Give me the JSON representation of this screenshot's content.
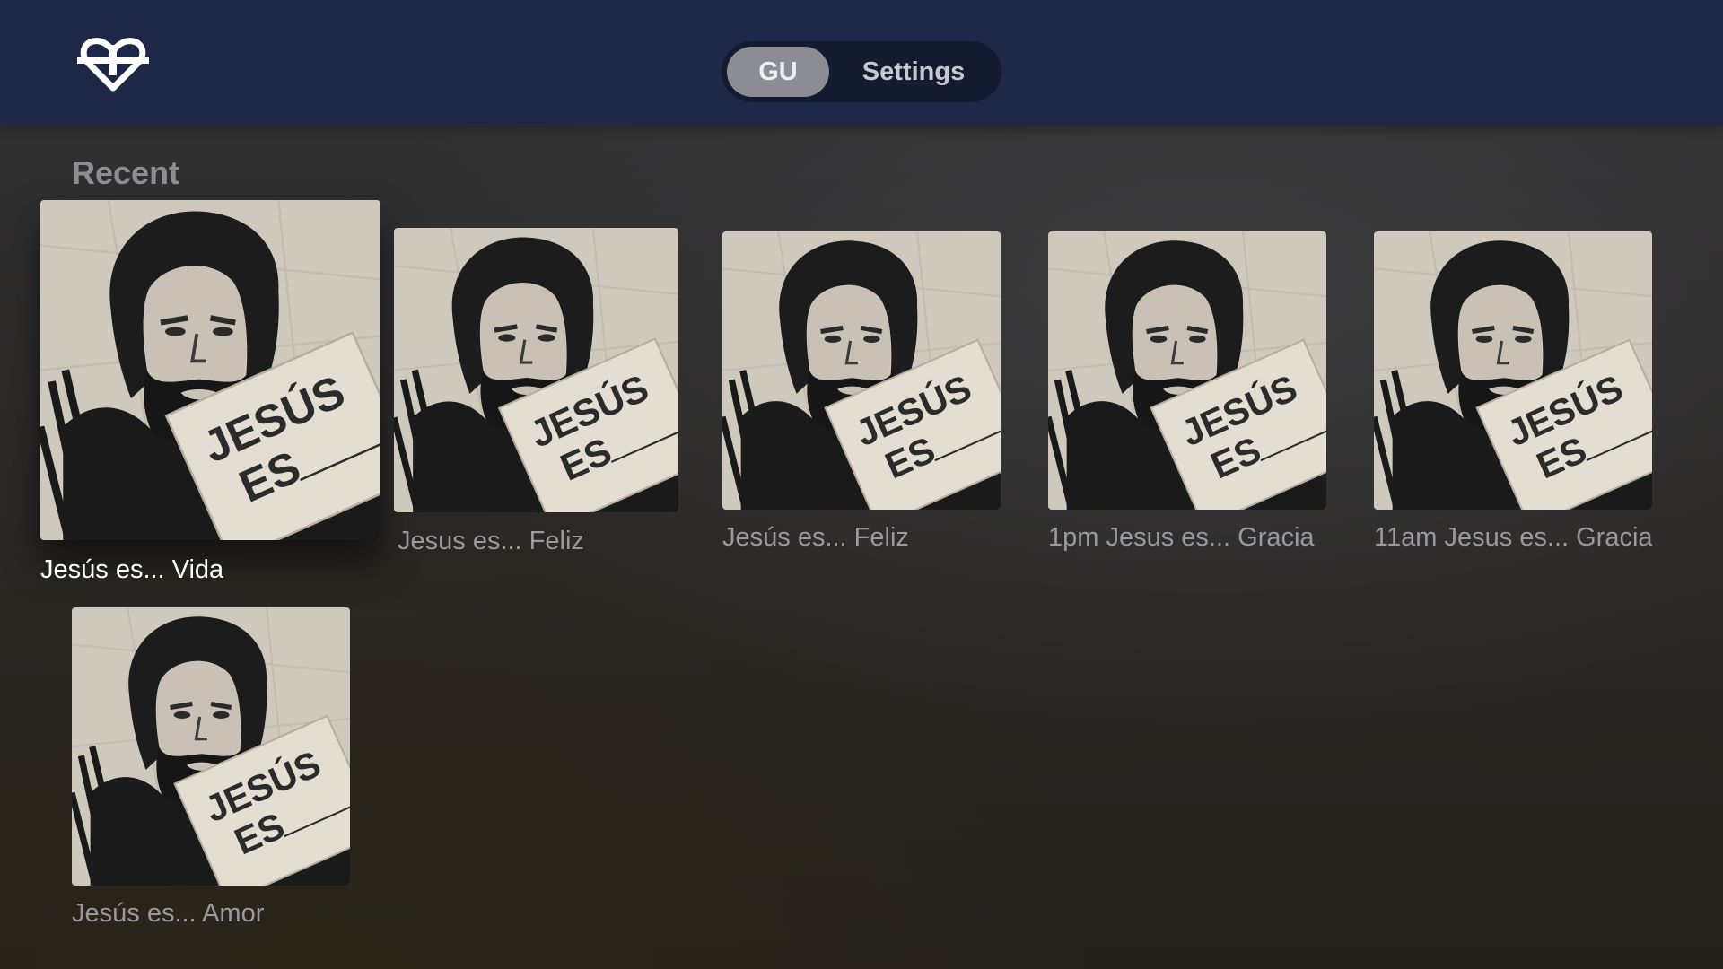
{
  "header": {
    "logo_icon": "heart-cross-icon",
    "tabs": [
      {
        "label": "GU",
        "selected": true
      },
      {
        "label": "Settings",
        "selected": false
      }
    ]
  },
  "section": {
    "title": "Recent"
  },
  "tiles": [
    {
      "title": "Jesús es... Vida",
      "focused": true,
      "artwork": "jesus-es-poster"
    },
    {
      "title": "Jesus es... Feliz",
      "focused": false,
      "artwork": "jesus-es-poster"
    },
    {
      "title": "Jesús es... Feliz",
      "focused": false,
      "artwork": "jesus-es-poster"
    },
    {
      "title": "1pm Jesus es... Gracia",
      "focused": false,
      "artwork": "jesus-es-poster"
    },
    {
      "title": "11am Jesus es... Gracia",
      "focused": false,
      "artwork": "jesus-es-poster"
    },
    {
      "title": "Jesús es... Amor",
      "focused": false,
      "artwork": "jesus-es-poster"
    }
  ],
  "artwork_text": {
    "line1": "JESÚS",
    "line2": "ES"
  },
  "colors": {
    "header_bg": "#1f2746",
    "tab_selected_bg": "#8b8d93",
    "poster_paper": "#d9d1c5"
  }
}
